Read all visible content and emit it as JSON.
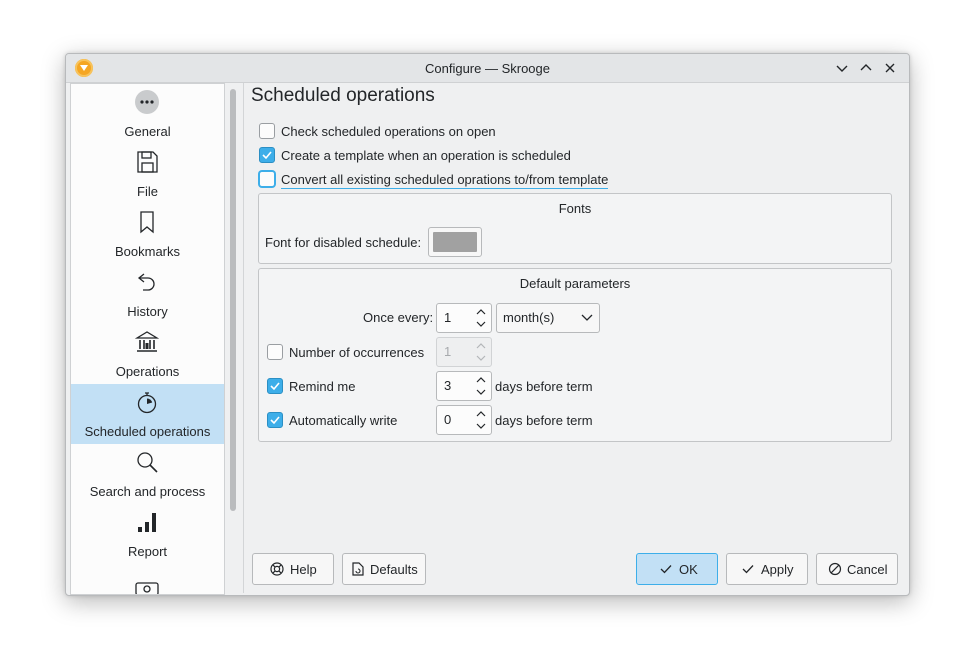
{
  "window": {
    "title": "Configure — Skrooge"
  },
  "sidebar": {
    "items": [
      {
        "label": "General",
        "icon": "dots-icon"
      },
      {
        "label": "File",
        "icon": "save-icon"
      },
      {
        "label": "Bookmarks",
        "icon": "bookmark-icon"
      },
      {
        "label": "History",
        "icon": "undo-icon"
      },
      {
        "label": "Operations",
        "icon": "bank-icon"
      },
      {
        "label": "Scheduled operations",
        "icon": "stopwatch-icon",
        "active": true
      },
      {
        "label": "Search and process",
        "icon": "search-icon"
      },
      {
        "label": "Report",
        "icon": "signal-bars-icon"
      }
    ]
  },
  "page": {
    "title": "Scheduled operations",
    "check_on_open": {
      "label": "Check scheduled operations on open",
      "checked": false
    },
    "create_template": {
      "label": "Create a template when an operation is scheduled",
      "checked": true
    },
    "convert_all": {
      "label": "Convert all existing scheduled oprations to/from template",
      "checked": false
    }
  },
  "fonts_group": {
    "title": "Fonts",
    "font_label": "Font for disabled schedule:",
    "swatch_color": "#a1a1a1"
  },
  "defaults_group": {
    "title": "Default parameters",
    "once_every_label": "Once every:",
    "once_every_value": "1",
    "period_value": "month(s)",
    "occurrences": {
      "label": "Number of occurrences",
      "checked": false,
      "value": "1"
    },
    "remind_me": {
      "label": "Remind me",
      "checked": true,
      "value": "3",
      "suffix": "days before term"
    },
    "auto_write": {
      "label": "Automatically write",
      "checked": true,
      "value": "0",
      "suffix": "days before term"
    }
  },
  "buttons": {
    "help": "Help",
    "defaults": "Defaults",
    "ok": "OK",
    "apply": "Apply",
    "cancel": "Cancel"
  },
  "colors": {
    "accent": "#3daee9",
    "selection": "#c2e0f5"
  }
}
